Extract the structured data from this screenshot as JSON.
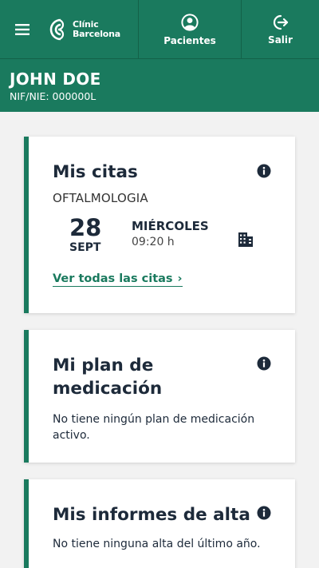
{
  "header": {
    "logo_line1": "Clínic",
    "logo_line2": "Barcelona",
    "pacientes_label": "Pacientes",
    "salir_label": "Salir",
    "menu_icon": "hamburger-icon",
    "user_icon": "user-circle-icon",
    "logout_icon": "logout-icon"
  },
  "patient": {
    "name": "JOHN DOE",
    "id": "NIF/NIE: 000000L"
  },
  "cards": {
    "citas": {
      "title": "Mis citas",
      "specialty": "OFTALMOLOGIA",
      "day": "28",
      "month": "SEPT",
      "weekday": "MIÉRCOLES",
      "time": "09:20 h",
      "link": "Ver todas las citas",
      "link_chevron": "›"
    },
    "medicacion": {
      "title_line1": "Mi plan de",
      "title_line2": "medicación",
      "text": "No tiene ningún plan de medicación activo."
    },
    "informes": {
      "title": "Mis informes de alta",
      "text": "No tiene ninguna alta del último año."
    }
  },
  "colors": {
    "brand_green": "#1a7a5e",
    "text_dark": "#1d2a3a",
    "background": "#f2f2f2"
  }
}
